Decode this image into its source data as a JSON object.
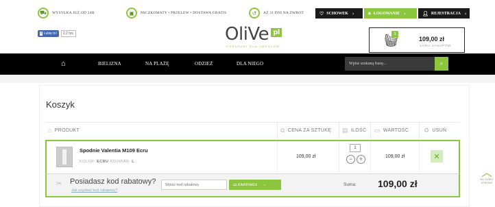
{
  "top_info": [
    {
      "icon": "truck-icon",
      "text": "Wysyłka już od 24h"
    },
    {
      "icon": "package-icon",
      "text": "Paczkomaty • przelew • dostawa gratis"
    },
    {
      "icon": "return-icon",
      "text": "Aż 31 dni na zwrot"
    }
  ],
  "top_buttons": {
    "schowek": "SCHOWEK",
    "logowanie": "LOGOWANIE",
    "rejestracja": "REJESTRACJA"
  },
  "facebook": {
    "label": "Lubię to!",
    "count": "2,2 tys."
  },
  "logo": {
    "main": "OliVe",
    "pl": "pl",
    "tagline": "Poduszki dla zmysłów"
  },
  "mini_cart": {
    "count": "1",
    "total": "109,00 zł",
    "label": "Suma zakupów"
  },
  "nav": {
    "items": [
      "BIELIZNA",
      "NA PLAŻĘ",
      "ODZIEŻ",
      "DLA NIEGO"
    ],
    "search_placeholder": "Wpisz szukaną frazę..."
  },
  "cart": {
    "title": "Koszyk",
    "headers": {
      "product": "PRODUKT",
      "unit_price": "CENA ZA SZTUKĘ",
      "quantity": "ILOŚĆ",
      "value": "WARTOŚĆ",
      "remove": "USUŃ"
    },
    "items": [
      {
        "name": "Spodnie Valentia M109 Ecru",
        "color_label": "KOLOR:",
        "color": "ECRU",
        "size_label": "ROZMIAR:",
        "size": "L",
        "unit_price": "109,00 zł",
        "quantity": "1",
        "value": "109,00 zł"
      }
    ],
    "promo": {
      "title": "Posiadasz kod rabatowy?",
      "link": "Jak uzyskać kod rabatowy?",
      "placeholder": "Wpisz kod rabatowy",
      "button": "ZASTOSUJ"
    },
    "sum_label": "Suma:",
    "sum_value": "109,00 zł"
  },
  "to_top": "Do góry strony"
}
